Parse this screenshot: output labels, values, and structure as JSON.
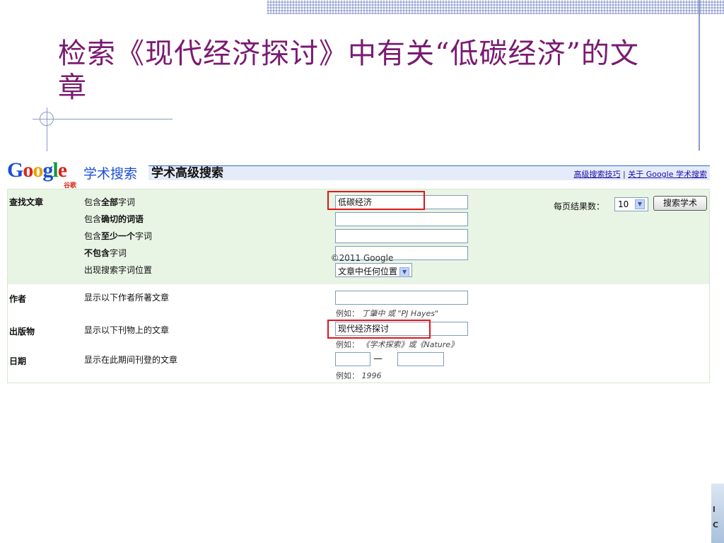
{
  "slide": {
    "title": "检索《现代经济探讨》中有关“低碳经济”的文章"
  },
  "scholar": {
    "logo_letters": [
      "G",
      "o",
      "o",
      "g",
      "l",
      "e"
    ],
    "logo_sub": "谷歌",
    "product_label": "学术搜索",
    "page_heading": "学术高级搜索",
    "link_tips": "高级搜索技巧",
    "link_sep": "|",
    "link_about": "关于 Google 学术搜索"
  },
  "find_articles": {
    "section_label": "查找文章",
    "rows": [
      {
        "pre": "包含",
        "bold": "全部",
        "post": "字词",
        "value": "低碳经济"
      },
      {
        "pre": "包含",
        "bold": "确切的词语",
        "post": "",
        "value": ""
      },
      {
        "pre": "包含",
        "bold": "至少一个",
        "post": "字词",
        "value": ""
      },
      {
        "pre": "",
        "bold": "不包含",
        "post": "字词",
        "value": ""
      }
    ],
    "position_label": "出现搜索字词位置",
    "position_value": "文章中任何位置",
    "results_per_page_label": "每页结果数：",
    "results_per_page_value": "10",
    "search_button": "搜索学术"
  },
  "author": {
    "section_label": "作者",
    "row_label": "显示以下作者所著文章",
    "value": "",
    "hint_prefix": "例如：",
    "hint_example": "丁肇中 或 \"PJ Hayes\""
  },
  "publication": {
    "section_label": "出版物",
    "row_label": "显示以下刊物上的文章",
    "value": "现代经济探讨",
    "hint_prefix": "例如：",
    "hint_example": "《学术探索》或《Nature》"
  },
  "date": {
    "section_label": "日期",
    "row_label": "显示在此期间刊登的文章",
    "from_value": "",
    "dash": "—",
    "to_value": "",
    "hint_prefix": "例如：",
    "hint_example": "1996"
  },
  "footer": {
    "copyright": "©2011 Google"
  },
  "colors": {
    "title": "#7a1a72",
    "highlight": "#e0151a",
    "panel": "#e8f4e4"
  }
}
